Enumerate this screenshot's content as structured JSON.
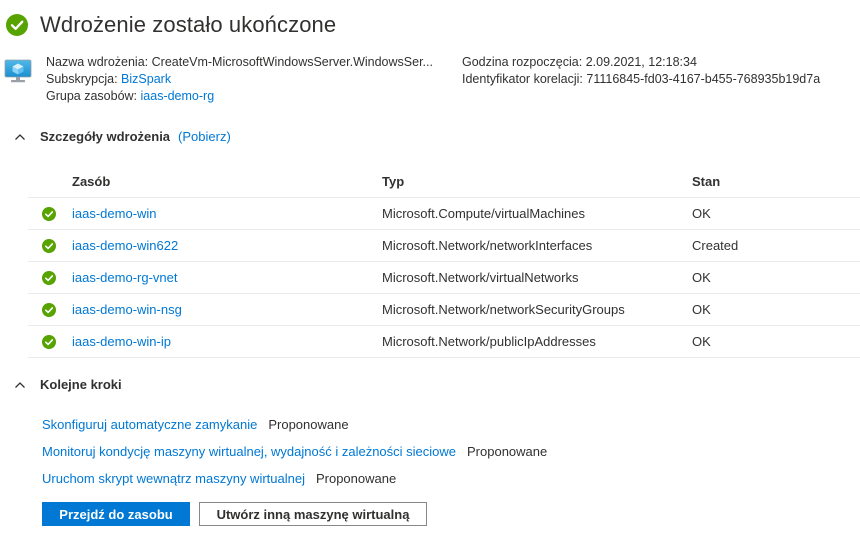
{
  "header": {
    "title": "Wdrożenie zostało ukończone"
  },
  "info": {
    "deployment_name_label": "Nazwa wdrożenia:",
    "deployment_name": "CreateVm-MicrosoftWindowsServer.WindowsSer...",
    "subscription_label": "Subskrypcja:",
    "subscription": "BizSpark",
    "resource_group_label": "Grupa zasobów:",
    "resource_group": "iaas-demo-rg",
    "start_time_label": "Godzina rozpoczęcia:",
    "start_time": "2.09.2021, 12:18:34",
    "correlation_id_label": "Identyfikator korelacji:",
    "correlation_id": "71116845-fd03-4167-b455-768935b19d7a"
  },
  "details": {
    "title": "Szczegóły wdrożenia",
    "download": "(Pobierz)",
    "columns": [
      "Zasób",
      "Typ",
      "Stan"
    ],
    "rows": [
      {
        "name": "iaas-demo-win",
        "type": "Microsoft.Compute/virtualMachines",
        "status": "OK"
      },
      {
        "name": "iaas-demo-win622",
        "type": "Microsoft.Network/networkInterfaces",
        "status": "Created"
      },
      {
        "name": "iaas-demo-rg-vnet",
        "type": "Microsoft.Network/virtualNetworks",
        "status": "OK"
      },
      {
        "name": "iaas-demo-win-nsg",
        "type": "Microsoft.Network/networkSecurityGroups",
        "status": "OK"
      },
      {
        "name": "iaas-demo-win-ip",
        "type": "Microsoft.Network/publicIpAddresses",
        "status": "OK"
      }
    ]
  },
  "next_steps": {
    "title": "Kolejne kroki",
    "items": [
      {
        "link": "Skonfiguruj automatyczne zamykanie",
        "status": "Proponowane"
      },
      {
        "link": "Monitoruj kondycję maszyny wirtualnej, wydajność i zależności sieciowe",
        "status": "Proponowane"
      },
      {
        "link": "Uruchom skrypt wewnątrz maszyny wirtualnej",
        "status": "Proponowane"
      }
    ]
  },
  "buttons": {
    "go_to_resource": "Przejdź do zasobu",
    "create_another": "Utwórz inną maszynę wirtualną"
  },
  "colors": {
    "success": "#57a300",
    "link": "#0078d4",
    "primary": "#0078d4"
  },
  "icons": {
    "success": "check-circle-icon",
    "vm": "virtual-machine-icon",
    "collapse": "chevron-up-icon"
  }
}
